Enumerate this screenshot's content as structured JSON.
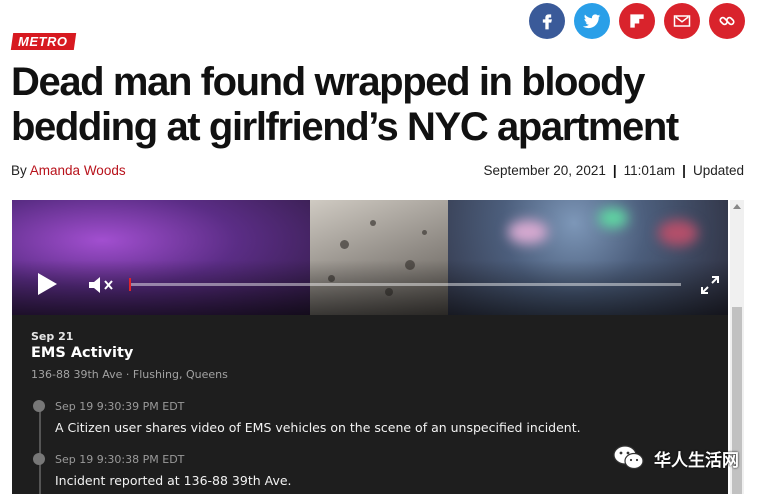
{
  "share": [
    {
      "icon": "facebook-icon",
      "color": "#3a5a99"
    },
    {
      "icon": "twitter-icon",
      "color": "#2a9fe8"
    },
    {
      "icon": "flipboard-icon",
      "color": "#d9232c"
    },
    {
      "icon": "email-icon",
      "color": "#d9232c"
    },
    {
      "icon": "link-icon",
      "color": "#d9232c"
    }
  ],
  "article": {
    "section": "METRO",
    "headline": "Dead man found wrapped in bloody bedding at girlfriend’s NYC apartment",
    "byline_prefix": "By",
    "author": "Amanda Woods",
    "date": "September 20, 2021",
    "time": "11:01am",
    "updated": "Updated",
    "separator": "|"
  },
  "video": {
    "played_fraction": 0.0
  },
  "feed": {
    "date": "Sep 21",
    "title": "EMS Activity",
    "location": "136-88 39th Ave · Flushing, Queens",
    "entries": [
      {
        "time": "Sep 19 9:30:39 PM EDT",
        "text": "A Citizen user shares video of EMS vehicles on the scene of an unspecified incident."
      },
      {
        "time": "Sep 19 9:30:38 PM EDT",
        "text": "Incident reported at 136-88 39th Ave."
      }
    ]
  },
  "watermark": "华人生活网"
}
